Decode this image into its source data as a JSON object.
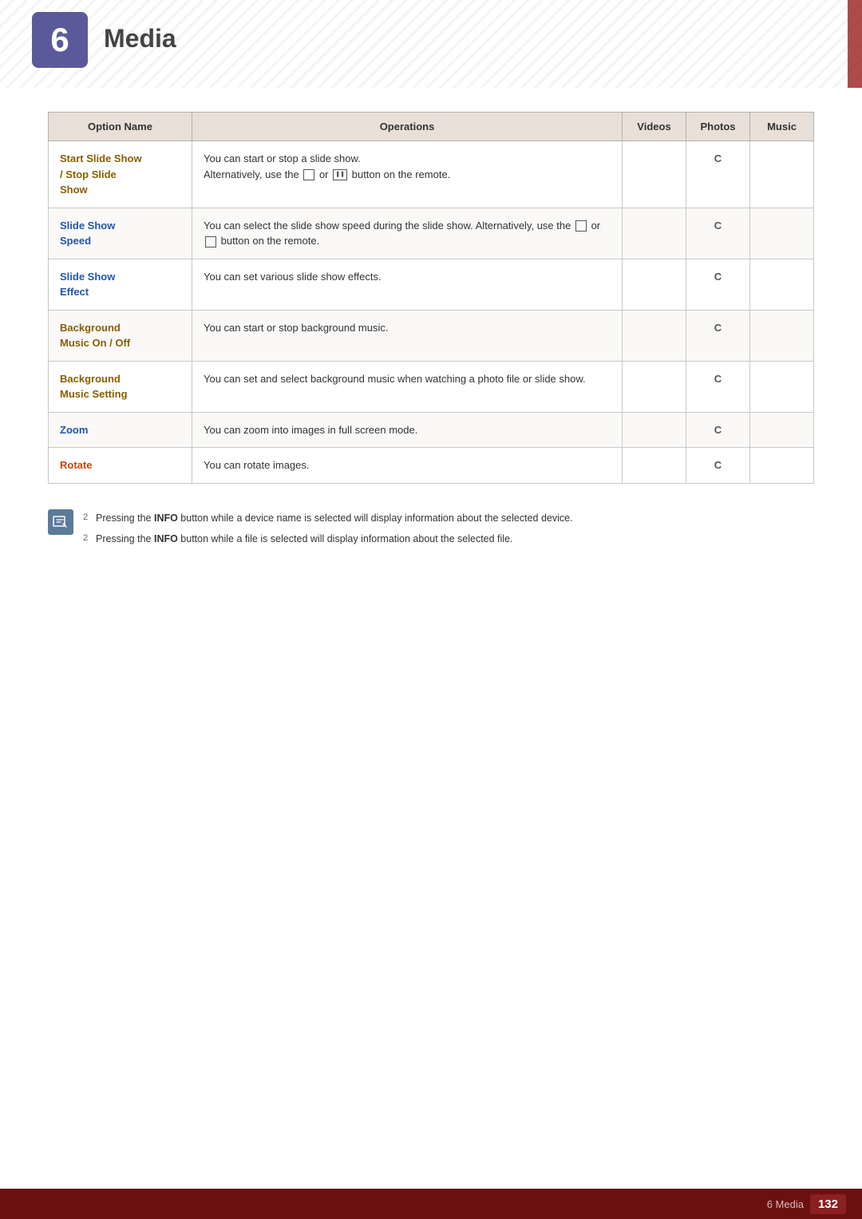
{
  "header": {
    "chapter_number": "6",
    "title": "Media",
    "badge_color": "#5a5a9a"
  },
  "table": {
    "headers": {
      "option_name": "Option Name",
      "operations": "Operations",
      "videos": "Videos",
      "photos": "Photos",
      "music": "Music"
    },
    "rows": [
      {
        "option": "Start Slide Show\n/ Stop Slide\nShow",
        "option_color": "brown",
        "operations": "You can start or stop a slide show.\nAlternatively, use the  or  button on the remote.",
        "videos": "",
        "photos": "C",
        "music": "",
        "has_icons": true
      },
      {
        "option": "Slide Show\nSpeed",
        "option_color": "blue",
        "operations": "You can select the slide show speed during the slide show. Alternatively, use the  or\n button on the remote.",
        "videos": "",
        "photos": "C",
        "music": "",
        "has_icons": true
      },
      {
        "option": "Slide Show\nEffect",
        "option_color": "blue",
        "operations": "You can set various slide show effects.",
        "videos": "",
        "photos": "C",
        "music": "",
        "has_icons": false
      },
      {
        "option": "Background\nMusic On / Off",
        "option_color": "brown",
        "operations": "You can start or stop background music.",
        "videos": "",
        "photos": "C",
        "music": "",
        "has_icons": false
      },
      {
        "option": "Background\nMusic Setting",
        "option_color": "brown",
        "operations": "You can set and select background music when watching a photo file or slide show.",
        "videos": "",
        "photos": "C",
        "music": "",
        "has_icons": false
      },
      {
        "option": "Zoom",
        "option_color": "blue",
        "operations": "You can zoom into images in full screen mode.",
        "videos": "",
        "photos": "C",
        "music": "",
        "has_icons": false
      },
      {
        "option": "Rotate",
        "option_color": "brown",
        "operations": "You can rotate images.",
        "videos": "",
        "photos": "C",
        "music": "",
        "has_icons": false
      }
    ]
  },
  "notes": [
    "Pressing the <strong>INFO</strong> button while a device name is selected will display information about the selected device.",
    "Pressing the <strong>INFO</strong> button while a file is selected will display information about the selected file."
  ],
  "footer": {
    "label": "6 Media",
    "page": "132"
  }
}
